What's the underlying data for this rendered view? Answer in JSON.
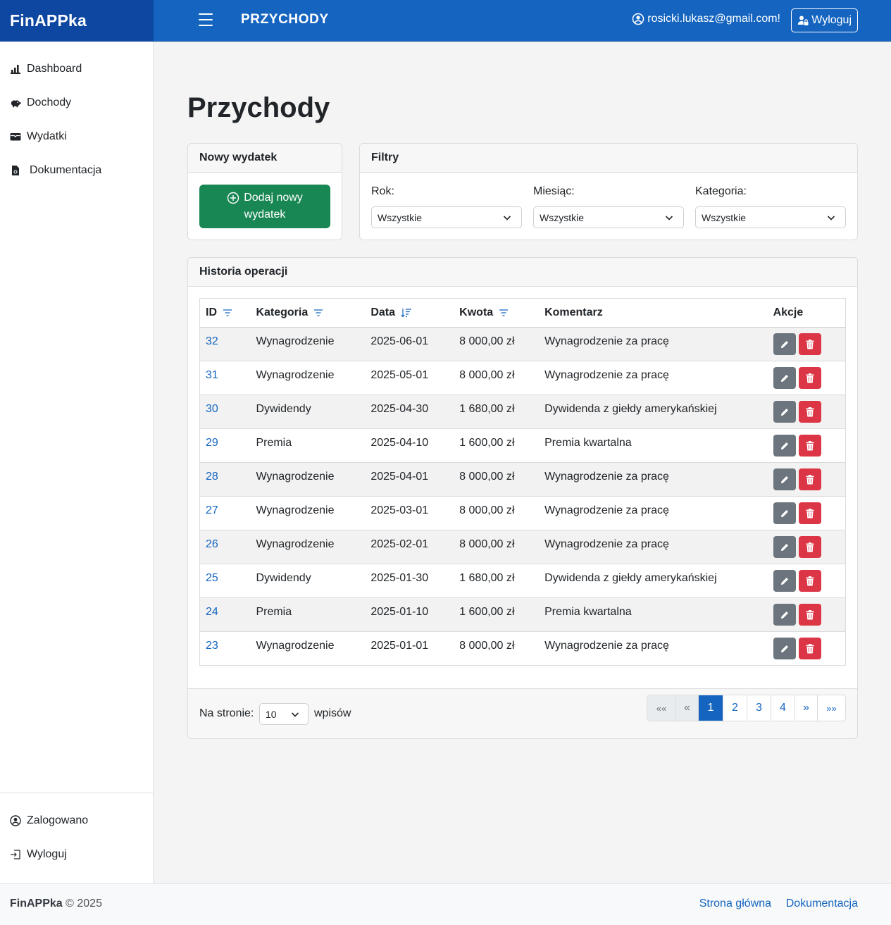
{
  "app": {
    "brand": "FinAPPka",
    "page_heading": "PRZYCHODY"
  },
  "topbar": {
    "user_email": "rosicki.lukasz@gmail.com!",
    "logout_label": "Wyloguj"
  },
  "sidebar": {
    "items": [
      {
        "label": "Dashboard",
        "icon": "bar-chart-icon"
      },
      {
        "label": "Dochody",
        "icon": "piggy-bank-icon"
      },
      {
        "label": "Wydatki",
        "icon": "wallet-icon"
      },
      {
        "label": "Dokumentacja",
        "icon": "document-icon"
      }
    ],
    "bottom": [
      {
        "label": "Zalogowano",
        "icon": "user-circle-icon"
      },
      {
        "label": "Wyloguj",
        "icon": "sign-out-icon"
      }
    ]
  },
  "main": {
    "title": "Przychody"
  },
  "new_card": {
    "title": "Nowy wydatek",
    "add_line1": "Dodaj nowy",
    "add_line2": "wydatek"
  },
  "filters": {
    "title": "Filtry",
    "year": {
      "label": "Rok:",
      "value": "Wszystkie"
    },
    "month": {
      "label": "Miesiąc:",
      "value": "Wszystkie"
    },
    "category": {
      "label": "Kategoria:",
      "value": "Wszystkie"
    }
  },
  "history": {
    "title": "Historia operacji",
    "columns": {
      "id": "ID",
      "category": "Kategoria",
      "date": "Data",
      "amount": "Kwota",
      "comment": "Komentarz",
      "actions": "Akcje"
    },
    "rows": [
      {
        "id": "32",
        "category": "Wynagrodzenie",
        "date": "2025-06-01",
        "amount": "8 000,00 zł",
        "comment": "Wynagrodzenie za pracę"
      },
      {
        "id": "31",
        "category": "Wynagrodzenie",
        "date": "2025-05-01",
        "amount": "8 000,00 zł",
        "comment": "Wynagrodzenie za pracę"
      },
      {
        "id": "30",
        "category": "Dywidendy",
        "date": "2025-04-30",
        "amount": "1 680,00 zł",
        "comment": "Dywidenda z giełdy amerykańskiej"
      },
      {
        "id": "29",
        "category": "Premia",
        "date": "2025-04-10",
        "amount": "1 600,00 zł",
        "comment": "Premia kwartalna"
      },
      {
        "id": "28",
        "category": "Wynagrodzenie",
        "date": "2025-04-01",
        "amount": "8 000,00 zł",
        "comment": "Wynagrodzenie za pracę"
      },
      {
        "id": "27",
        "category": "Wynagrodzenie",
        "date": "2025-03-01",
        "amount": "8 000,00 zł",
        "comment": "Wynagrodzenie za pracę"
      },
      {
        "id": "26",
        "category": "Wynagrodzenie",
        "date": "2025-02-01",
        "amount": "8 000,00 zł",
        "comment": "Wynagrodzenie za pracę"
      },
      {
        "id": "25",
        "category": "Dywidendy",
        "date": "2025-01-30",
        "amount": "1 680,00 zł",
        "comment": "Dywidenda z giełdy amerykańskiej"
      },
      {
        "id": "24",
        "category": "Premia",
        "date": "2025-01-10",
        "amount": "1 600,00 zł",
        "comment": "Premia kwartalna"
      },
      {
        "id": "23",
        "category": "Wynagrodzenie",
        "date": "2025-01-01",
        "amount": "8 000,00 zł",
        "comment": "Wynagrodzenie za pracę"
      }
    ],
    "per_page_label": "Na stronie:",
    "per_page_value": "10",
    "per_page_after": "wpisów",
    "pagination": [
      {
        "label": "««",
        "state": "disabled"
      },
      {
        "label": "«",
        "state": "disabled"
      },
      {
        "label": "1",
        "state": "active"
      },
      {
        "label": "2",
        "state": "normal"
      },
      {
        "label": "3",
        "state": "normal"
      },
      {
        "label": "4",
        "state": "normal"
      },
      {
        "label": "»",
        "state": "normal"
      },
      {
        "label": "»»",
        "state": "normal"
      }
    ]
  },
  "footer": {
    "brand": "FinAPPka",
    "copyright": "© 2025",
    "link_home": "Strona główna",
    "link_docs": "Dokumentacja"
  },
  "colors": {
    "brand_dark": "#0d47a1",
    "topbar": "#1565c0",
    "success": "#198754",
    "danger": "#dc3545",
    "secondary": "#6c757d"
  }
}
